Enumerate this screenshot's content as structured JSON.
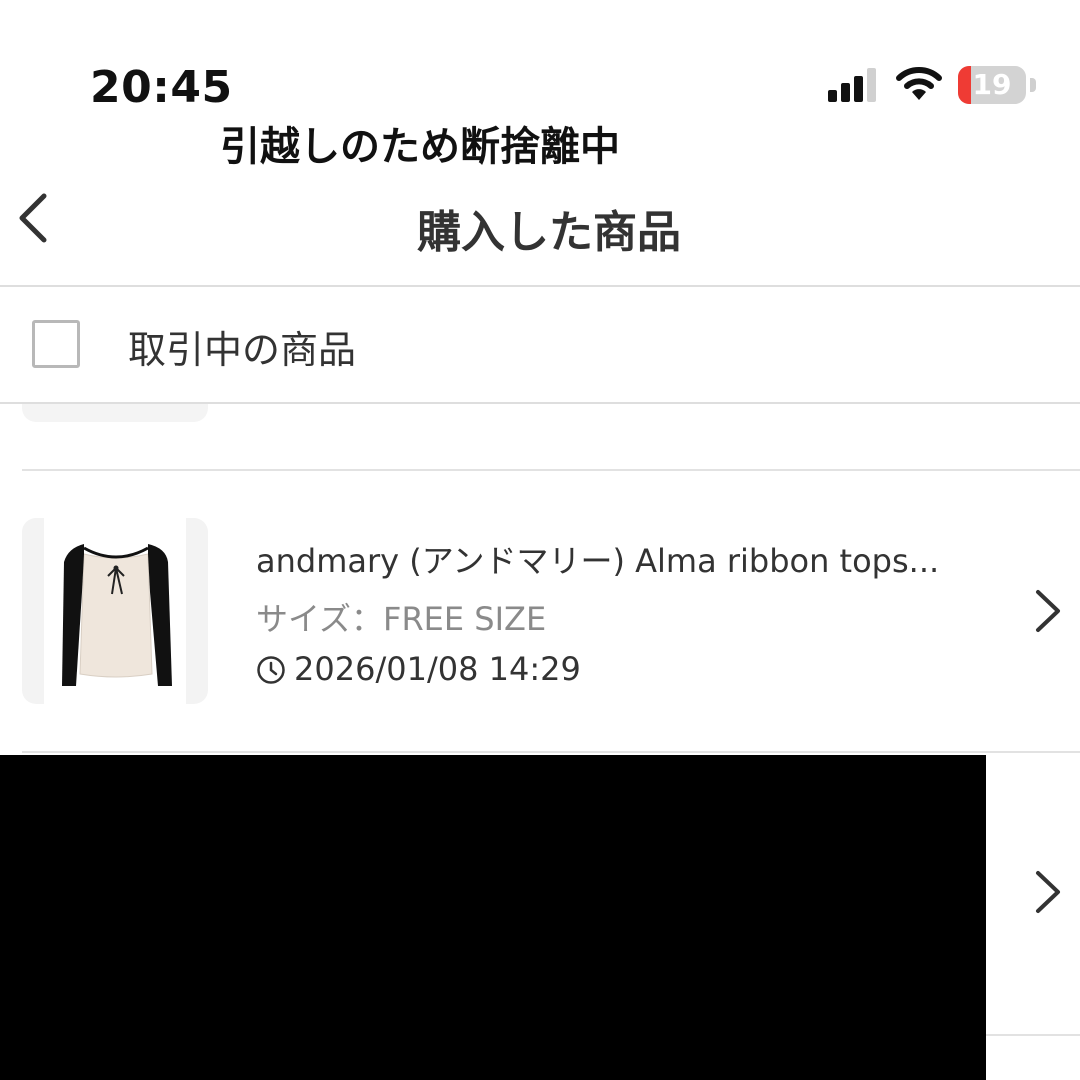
{
  "status_bar": {
    "time": "20:45",
    "battery_level": "19",
    "battery_fraction": 0.19,
    "signal_bars_active": 3,
    "signal_bars_total": 4,
    "icons": [
      "signal-icon",
      "wifi-icon",
      "battery-icon"
    ]
  },
  "overlay_caption": "引越しのため断捨離中",
  "nav": {
    "back_icon": "chevron-left-icon",
    "title": "購入した商品"
  },
  "filter": {
    "checkbox_checked": false,
    "label": "取引中の商品"
  },
  "items": [
    {
      "name": "andmary (アンドマリー) Alma ribbon tops...",
      "size": "サイズ：FREE SIZE",
      "date": "2026/01/08 14:29",
      "clock_icon": "clock-icon",
      "chevron_icon": "chevron-right-icon",
      "thumbnail_icon": "ribbon-top-thumbnail"
    }
  ],
  "colors": {
    "battery_low": "#ef3b34",
    "divider": "#dedede",
    "secondary_text": "#8a8a8a"
  }
}
